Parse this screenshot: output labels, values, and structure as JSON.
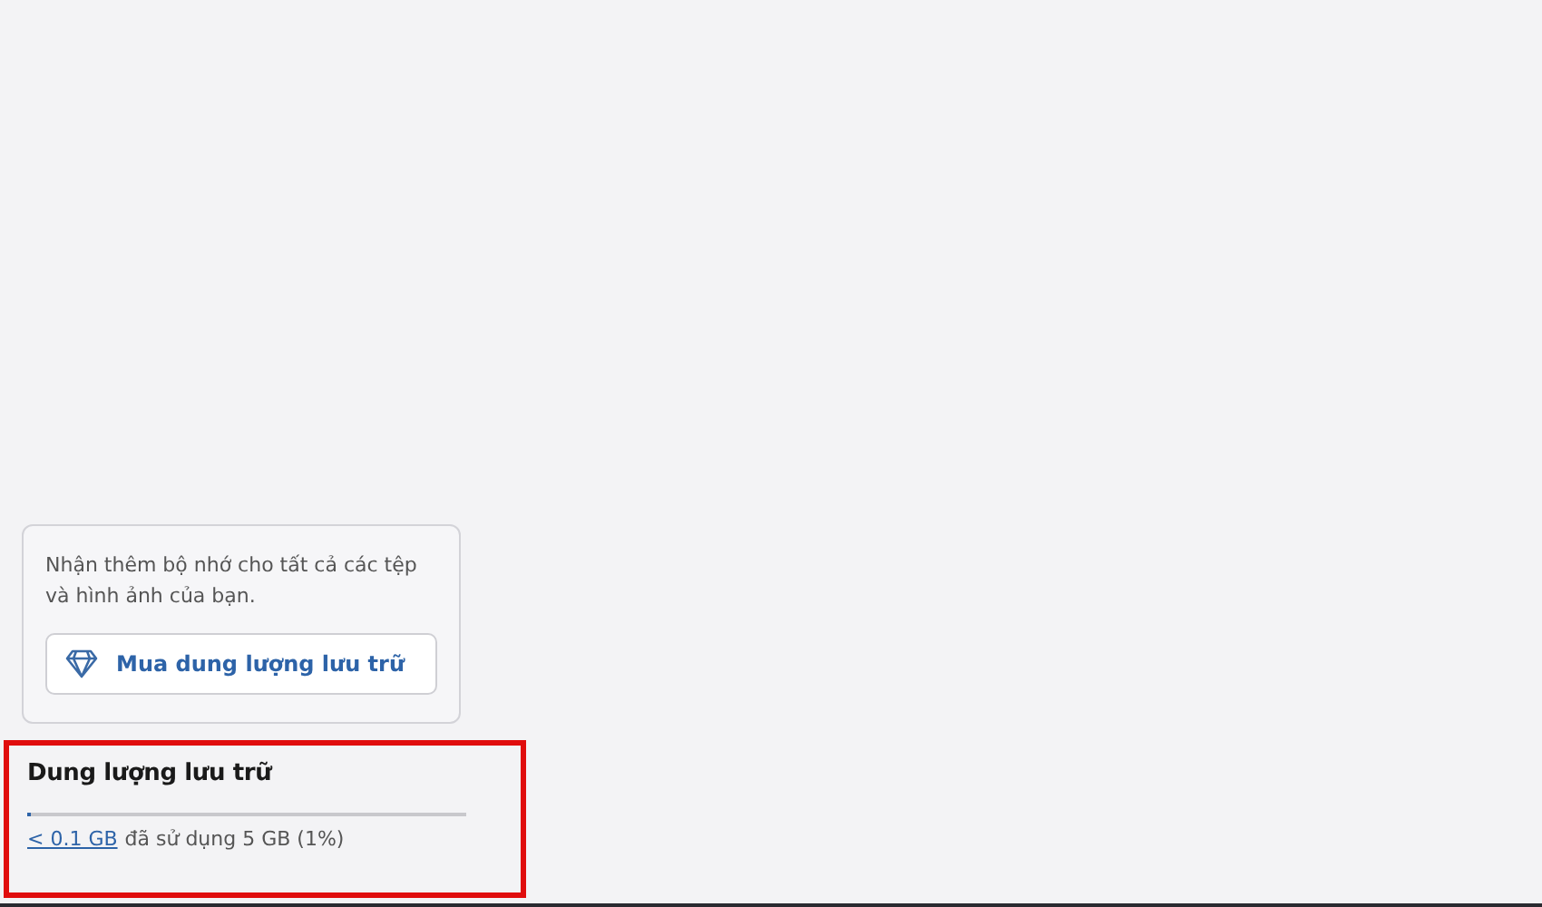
{
  "promo_card": {
    "text": "Nhận thêm bộ nhớ cho tất cả các tệp và hình ảnh của bạn.",
    "button": "Mua dung lượng lưu trữ"
  },
  "storage": {
    "title": "Dung lượng lưu trữ",
    "level": 0.01,
    "used": "< 0.1 GB",
    "usage_text": "đã sử dụng 5 GB (1%)",
    "highlighted": true
  }
}
